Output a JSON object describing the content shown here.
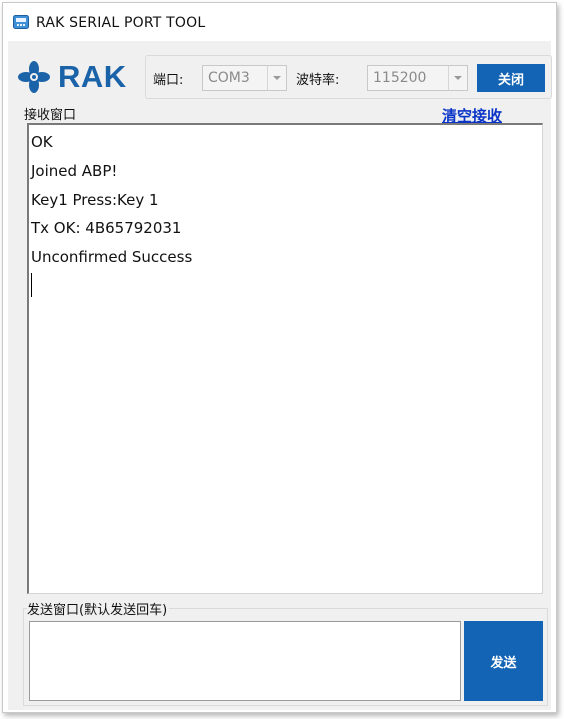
{
  "window": {
    "title": "RAK SERIAL PORT TOOL"
  },
  "logo": {
    "text": "RAK",
    "brand_color": "#1b63a8"
  },
  "port": {
    "label": "端口:",
    "value": "COM3"
  },
  "baud": {
    "label": "波特率:",
    "value": "115200"
  },
  "buttons": {
    "close_label": "关闭",
    "send_label": "发送",
    "accent_color": "#1464b5"
  },
  "receive": {
    "label": "接收窗口",
    "clear_label": "清空接收",
    "lines": [
      "OK",
      "Joined ABP!",
      "Key1 Press:Key 1",
      "Tx OK: 4B65792031",
      "Unconfirmed Success"
    ]
  },
  "send": {
    "label": "发送窗口(默认发送回车)",
    "value": ""
  }
}
